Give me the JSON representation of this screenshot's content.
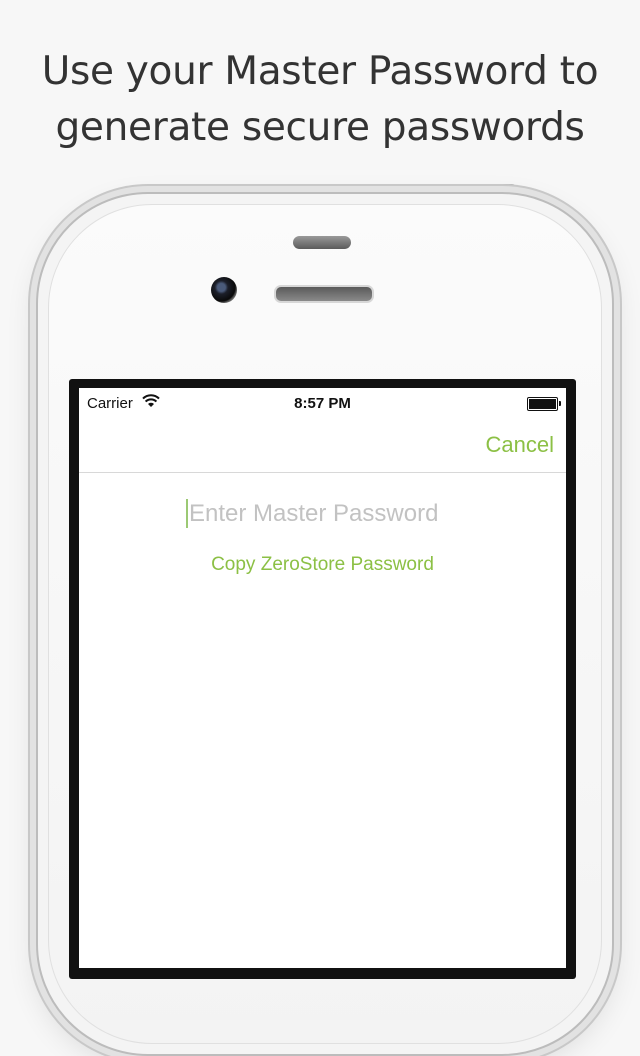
{
  "headline": {
    "line1": "Use your Master Password to",
    "line2": "generate secure passwords"
  },
  "status_bar": {
    "carrier": "Carrier",
    "time": "8:57 PM",
    "wifi_icon": "wifi-icon",
    "battery_icon": "battery-icon"
  },
  "nav_bar": {
    "cancel_label": "Cancel"
  },
  "master_password": {
    "value": "",
    "placeholder": "Enter Master Password"
  },
  "copy_link": {
    "label": "Copy ZeroStore Password"
  },
  "colors": {
    "accent": "#8cc045",
    "headline_text": "#333333",
    "background": "#f7f7f7"
  }
}
